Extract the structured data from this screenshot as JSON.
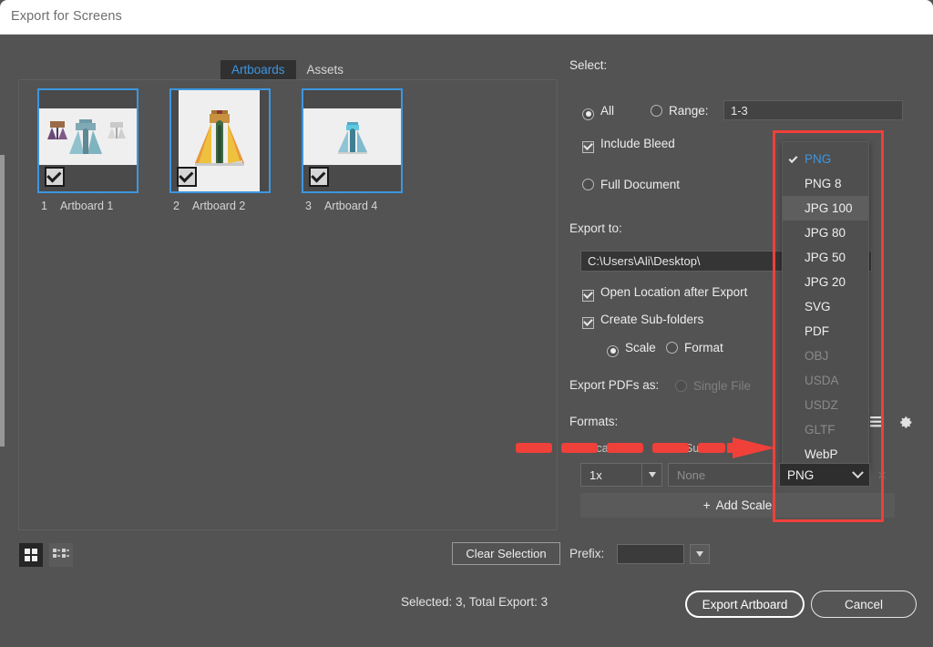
{
  "window": {
    "title": "Export for Screens"
  },
  "tabs": [
    {
      "label": "Artboards",
      "active": true
    },
    {
      "label": "Assets",
      "active": false
    }
  ],
  "artboards": [
    {
      "number": "1",
      "name": "Artboard 1",
      "checked": true,
      "variant": "full"
    },
    {
      "number": "2",
      "name": "Artboard 2",
      "checked": true,
      "variant": "tall"
    },
    {
      "number": "3",
      "name": "Artboard 4",
      "checked": true,
      "variant": "mid"
    }
  ],
  "view_toggles": {
    "grid_label": "grid-view",
    "list_label": "list-view"
  },
  "left_footer": {
    "clear_selection_label": "Clear Selection",
    "prefix_label": "Prefix:",
    "prefix_value": ""
  },
  "select_section": {
    "title": "Select:",
    "all_label": "All",
    "all_selected": true,
    "range_label": "Range:",
    "range_selected": false,
    "range_value": "1-3",
    "include_bleed_label": "Include Bleed",
    "include_bleed_checked": true,
    "full_document_label": "Full Document",
    "full_document_selected": false
  },
  "export_to_section": {
    "title": "Export to:",
    "path_value": "C:\\Users\\Ali\\Desktop\\",
    "open_location_label": "Open Location after Export",
    "open_location_checked": true,
    "create_subfolders_label": "Create Sub-folders",
    "create_subfolders_checked": true,
    "subfolder_scale_label": "Scale",
    "subfolder_scale_selected": true,
    "subfolder_format_label": "Format",
    "subfolder_format_selected": false
  },
  "pdf_section": {
    "label": "Export PDFs as:",
    "single_file_label": "Single File",
    "single_file_selected": false,
    "single_file_disabled": true
  },
  "formats_section": {
    "title": "Formats:",
    "col_scale": "Scale",
    "col_suffix": "Suffix",
    "scale_value": "1x",
    "suffix_placeholder": "None",
    "format_value": "PNG",
    "add_scale_label": "Add Scale",
    "add_scale_plus": "+",
    "remove_label": "×"
  },
  "format_dropdown": {
    "open": true,
    "selected": "PNG",
    "highlighted": "JPG 100",
    "items": [
      {
        "label": "PNG",
        "selected": true,
        "disabled": false
      },
      {
        "label": "PNG 8",
        "selected": false,
        "disabled": false
      },
      {
        "label": "JPG 100",
        "selected": false,
        "disabled": false
      },
      {
        "label": "JPG 80",
        "selected": false,
        "disabled": false
      },
      {
        "label": "JPG 50",
        "selected": false,
        "disabled": false
      },
      {
        "label": "JPG 20",
        "selected": false,
        "disabled": false
      },
      {
        "label": "SVG",
        "selected": false,
        "disabled": false
      },
      {
        "label": "PDF",
        "selected": false,
        "disabled": false
      },
      {
        "label": "OBJ",
        "selected": false,
        "disabled": true
      },
      {
        "label": "USDA",
        "selected": false,
        "disabled": true
      },
      {
        "label": "USDZ",
        "selected": false,
        "disabled": true
      },
      {
        "label": "GLTF",
        "selected": false,
        "disabled": true
      },
      {
        "label": "WebP",
        "selected": false,
        "disabled": false
      }
    ]
  },
  "footer": {
    "status": "Selected: 3, Total Export: 3",
    "export_label": "Export Artboard",
    "cancel_label": "Cancel"
  },
  "colors": {
    "accent_blue": "#3d96e0",
    "annotation_red": "#f0403a",
    "panel_bg": "#535353",
    "titlebar_bg": "#ffffff"
  }
}
